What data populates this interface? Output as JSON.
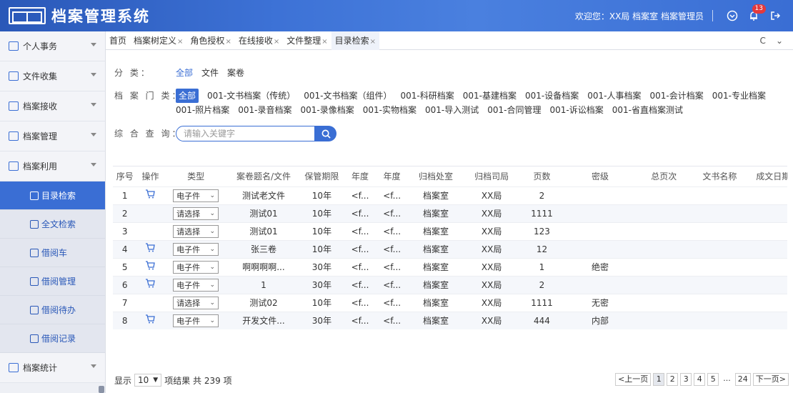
{
  "header": {
    "app_title": "档案管理系统",
    "welcome": "欢迎您：XX局 档案室 档案管理员",
    "notification_count": "13"
  },
  "sidebar": {
    "items": [
      {
        "label": "个人事务"
      },
      {
        "label": "文件收集"
      },
      {
        "label": "档案接收"
      },
      {
        "label": "档案管理"
      },
      {
        "label": "档案利用"
      }
    ],
    "subitems": [
      {
        "label": "目录检索"
      },
      {
        "label": "全文检索"
      },
      {
        "label": "借阅车"
      },
      {
        "label": "借阅管理"
      },
      {
        "label": "借阅待办"
      },
      {
        "label": "借阅记录"
      }
    ],
    "bottom_item": {
      "label": "档案统计"
    }
  },
  "tabs": [
    {
      "label": "首页",
      "closable": false
    },
    {
      "label": "档案树定义",
      "closable": true
    },
    {
      "label": "角色授权",
      "closable": true
    },
    {
      "label": "在线接收",
      "closable": true
    },
    {
      "label": "文件整理",
      "closable": true
    },
    {
      "label": "目录检索",
      "closable": true
    }
  ],
  "tab_close_glyph": "×",
  "tab_tools": {
    "refresh": "C",
    "collapse": "⌄"
  },
  "filters": {
    "category": {
      "label": "分      类：",
      "options": [
        "全部",
        "文件",
        "案卷"
      ]
    },
    "archive_type": {
      "label": "档 案 门 类：",
      "options": [
        "全部",
        "001-文书档案（传统）",
        "001-文书档案（组件）",
        "001-科研档案",
        "001-基建档案",
        "001-设备档案",
        "001-人事档案",
        "001-会计档案",
        "001-专业档案",
        "001-照片档案",
        "001-录音档案",
        "001-录像档案",
        "001-实物档案",
        "001-导入测试",
        "001-合同管理",
        "001-诉讼档案",
        "001-省直档案测试"
      ]
    },
    "search": {
      "label": "综 合 查 询：",
      "placeholder": "请输入关键字"
    }
  },
  "table": {
    "columns": [
      "序号",
      "操作",
      "类型",
      "案卷题名/文件",
      "保管期限",
      "年度",
      "年度",
      "归档处室",
      "归档司局",
      "页数",
      "密级",
      "总页次",
      "文书名称",
      "成文日期"
    ],
    "rows": [
      {
        "no": "1",
        "cart": true,
        "type": "电子件",
        "title": "测试老文件",
        "period": "10年",
        "y1": "<f...",
        "y2": "<f...",
        "dept": "档案室",
        "bureau": "XX局",
        "pages": "2",
        "secret": ""
      },
      {
        "no": "2",
        "cart": false,
        "type": "请选择",
        "title": "测试01",
        "period": "10年",
        "y1": "<f...",
        "y2": "<f...",
        "dept": "档案室",
        "bureau": "XX局",
        "pages": "1111",
        "secret": ""
      },
      {
        "no": "3",
        "cart": false,
        "type": "请选择",
        "title": "测试01",
        "period": "10年",
        "y1": "<f...",
        "y2": "<f...",
        "dept": "档案室",
        "bureau": "XX局",
        "pages": "123",
        "secret": ""
      },
      {
        "no": "4",
        "cart": true,
        "type": "电子件",
        "title": "张三卷",
        "period": "10年",
        "y1": "<f...",
        "y2": "<f...",
        "dept": "档案室",
        "bureau": "XX局",
        "pages": "12",
        "secret": ""
      },
      {
        "no": "5",
        "cart": true,
        "type": "电子件",
        "title": "啊啊啊啊...",
        "period": "30年",
        "y1": "<f...",
        "y2": "<f...",
        "dept": "档案室",
        "bureau": "XX局",
        "pages": "1",
        "secret": "绝密"
      },
      {
        "no": "6",
        "cart": true,
        "type": "电子件",
        "title": "1",
        "period": "30年",
        "y1": "<f...",
        "y2": "<f...",
        "dept": "档案室",
        "bureau": "XX局",
        "pages": "2",
        "secret": ""
      },
      {
        "no": "7",
        "cart": false,
        "type": "请选择",
        "title": "测试02",
        "period": "10年",
        "y1": "<f...",
        "y2": "<f...",
        "dept": "档案室",
        "bureau": "XX局",
        "pages": "1111",
        "secret": "无密"
      },
      {
        "no": "8",
        "cart": true,
        "type": "电子件",
        "title": "开发文件...",
        "period": "30年",
        "y1": "<f...",
        "y2": "<f...",
        "dept": "档案室",
        "bureau": "XX局",
        "pages": "444",
        "secret": "内部"
      }
    ]
  },
  "footer": {
    "show_label": "显示",
    "page_size": "10",
    "result_text": "项结果 共 239 项",
    "prev": "<上一页",
    "pages": [
      "1",
      "2",
      "3",
      "4",
      "5"
    ],
    "ellipsis": "...",
    "last_page": "24",
    "next": "下一页>"
  },
  "colors": {
    "accent": "#3a6ed4",
    "header": "#2a58b8",
    "badge": "#e4393c"
  }
}
